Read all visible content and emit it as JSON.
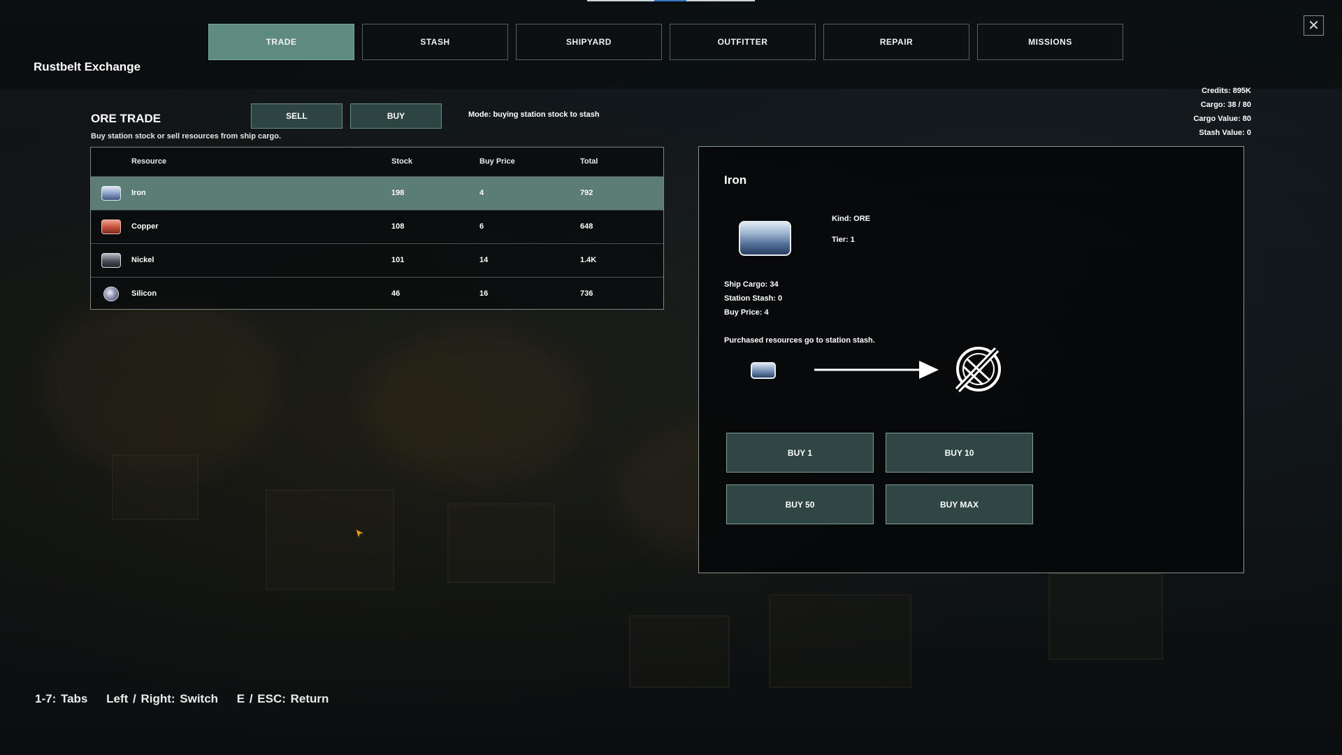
{
  "station": {
    "title": "Rustbelt Exchange"
  },
  "tabs": [
    {
      "label": "TRADE",
      "active": true
    },
    {
      "label": "STASH",
      "active": false
    },
    {
      "label": "SHIPYARD",
      "active": false
    },
    {
      "label": "OUTFITTER",
      "active": false
    },
    {
      "label": "REPAIR",
      "active": false
    },
    {
      "label": "MISSIONS",
      "active": false
    }
  ],
  "stats": {
    "credits": "Credits: 895K",
    "cargo": "Cargo: 38 / 80",
    "cargo_value": "Cargo Value: 80",
    "stash_value": "Stash Value: 0"
  },
  "ore_trade": {
    "title": "ORE TRADE",
    "subtitle": "Buy station stock or sell resources from ship cargo.",
    "sell_label": "SELL",
    "buy_label": "BUY",
    "mode": "Mode: buying station stock to stash"
  },
  "table": {
    "headers": {
      "resource": "Resource",
      "stock": "Stock",
      "price": "Buy Price",
      "total": "Total"
    },
    "rows": [
      {
        "name": "Iron",
        "stock": "198",
        "price": "4",
        "total": "792",
        "icon": "iron-ore-icon",
        "color": "#8fa3c7"
      },
      {
        "name": "Copper",
        "stock": "108",
        "price": "6",
        "total": "648",
        "icon": "copper-ore-icon",
        "color": "#c8563f"
      },
      {
        "name": "Nickel",
        "stock": "101",
        "price": "14",
        "total": "1.4K",
        "icon": "nickel-ore-icon",
        "color": "#4a4f58"
      },
      {
        "name": "Silicon",
        "stock": "46",
        "price": "16",
        "total": "736",
        "icon": "silicon-ore-icon",
        "color": "#7c7f9e"
      }
    ]
  },
  "detail": {
    "name": "Iron",
    "kind": "Kind: ORE",
    "tier": "Tier: 1",
    "ship_cargo": "Ship Cargo: 34",
    "station_stash": "Station Stash: 0",
    "buy_price": "Buy Price: 4",
    "note": "Purchased resources go to station stash.",
    "buttons": {
      "buy1": "BUY 1",
      "buy10": "BUY 10",
      "buy50": "BUY 50",
      "buymax": "BUY MAX"
    }
  },
  "hints": {
    "tabs": "1-7: Tabs",
    "switch": "Left / Right: Switch",
    "return": "E / ESC: Return"
  },
  "colors": {
    "accent": "#5e8a80",
    "button": "#2f4645",
    "panel": "#0c1012"
  }
}
